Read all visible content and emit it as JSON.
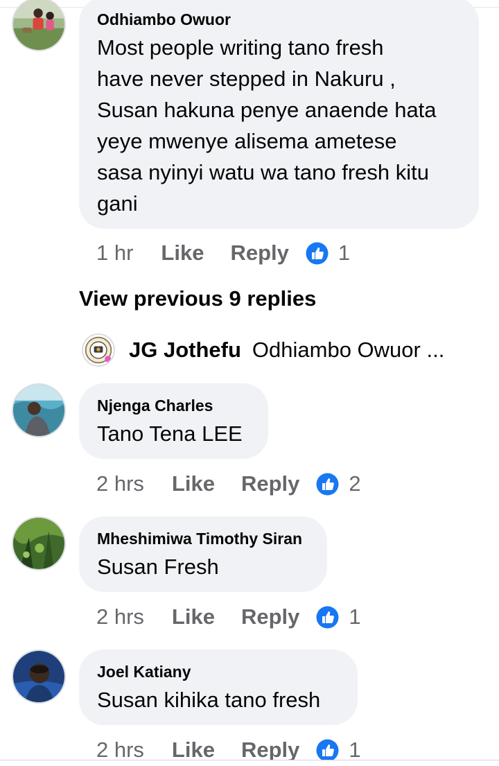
{
  "comments": [
    {
      "author": "Odhiambo Owuor",
      "text": "Most people writing tano fresh\nhave never stepped in Nakuru ,\nSusan hakuna penye anaende hata\nyeye mwenye alisema ametese\nsasa nyinyi watu wa tano fresh kitu\ngani",
      "time": "1 hr",
      "like_label": "Like",
      "reply_label": "Reply",
      "reaction_count": "1"
    },
    {
      "author": "Njenga Charles",
      "text": "Tano Tena LEE",
      "time": "2 hrs",
      "like_label": "Like",
      "reply_label": "Reply",
      "reaction_count": "2"
    },
    {
      "author": "Mheshimiwa Timothy Siran",
      "text": "Susan Fresh",
      "time": "2 hrs",
      "like_label": "Like",
      "reply_label": "Reply",
      "reaction_count": "1"
    },
    {
      "author": "Joel Katiany",
      "text": "Susan kihika tano fresh",
      "time": "2 hrs",
      "like_label": "Like",
      "reply_label": "Reply",
      "reaction_count": "1"
    }
  ],
  "view_previous_replies": "View previous 9 replies",
  "reply_preview": {
    "author": "JG Jothefu",
    "text": "Odhiambo Owuor ..."
  },
  "colors": {
    "bubble": "#f0f2f5",
    "muted_text": "#65676b",
    "like_blue": "#1877f2",
    "text": "#050505"
  },
  "icons": {
    "reaction": "like-thumbs-up-icon",
    "avatar": "profile-photo"
  }
}
